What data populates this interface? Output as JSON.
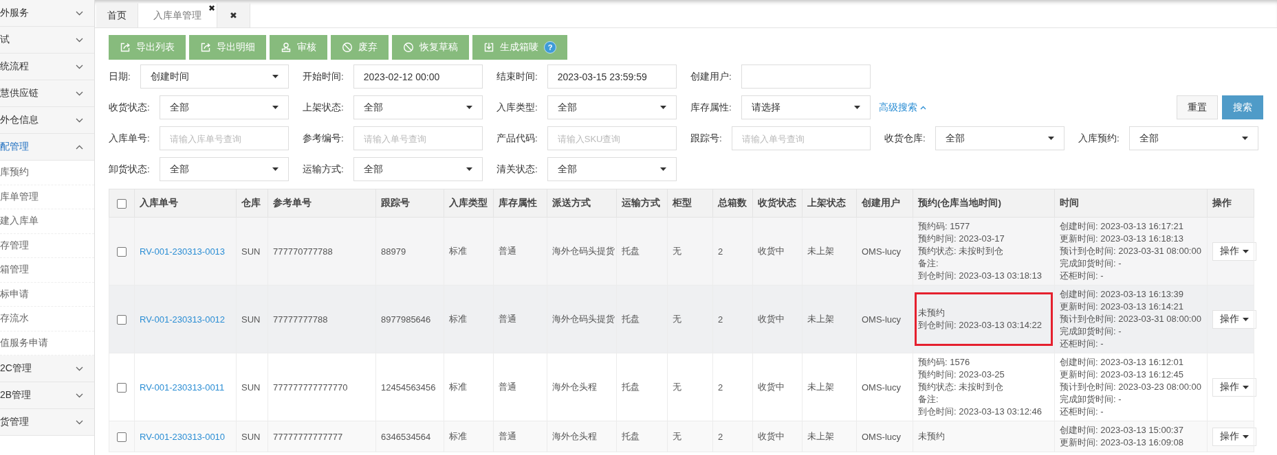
{
  "sidebar": {
    "groups": [
      {
        "label": "外服务",
        "expanded": false
      },
      {
        "label": "试",
        "expanded": false
      },
      {
        "label": "统流程",
        "expanded": false
      },
      {
        "label": "慧供应链",
        "expanded": false
      },
      {
        "label": "外仓信息",
        "expanded": false
      },
      {
        "label": "配管理",
        "expanded": true,
        "children": [
          {
            "label": "库预约"
          },
          {
            "label": "库单管理"
          },
          {
            "label": "建入库单"
          },
          {
            "label": "存管理"
          },
          {
            "label": "箱管理"
          },
          {
            "label": "标申请"
          },
          {
            "label": "存流水"
          },
          {
            "label": "值服务申请"
          }
        ]
      },
      {
        "label": "2C管理",
        "expanded": false
      },
      {
        "label": "2B管理",
        "expanded": false
      },
      {
        "label": "货管理",
        "expanded": false
      }
    ]
  },
  "tabs": [
    {
      "label": "首页",
      "selected": false
    },
    {
      "label": "入库单管理",
      "selected": true,
      "close": "✖"
    }
  ],
  "close_all_tab": "✖",
  "toolbar": [
    {
      "label": "导出列表"
    },
    {
      "label": "导出明细"
    },
    {
      "label": "审核"
    },
    {
      "label": "废弃"
    },
    {
      "label": "恢复草稿"
    },
    {
      "label": "生成箱唛",
      "help": "?"
    }
  ],
  "filters": [
    [
      {
        "label": "日期:",
        "kind": "select",
        "value": "创建时间"
      },
      {
        "label": "开始时间:",
        "kind": "input",
        "value": "2023-02-12 00:00"
      },
      {
        "label": "结束时间:",
        "kind": "input",
        "value": "2023-03-15 23:59:59"
      },
      {
        "label": "创建用户:",
        "kind": "input"
      }
    ],
    [
      {
        "label": "收货状态:",
        "kind": "select",
        "value": "全部"
      },
      {
        "label": "上架状态:",
        "kind": "select",
        "value": "全部"
      },
      {
        "label": "入库类型:",
        "kind": "select",
        "value": "全部"
      },
      {
        "label": "库存属性:",
        "kind": "select",
        "value": "请选择"
      }
    ],
    [
      {
        "label": "入库单号:",
        "kind": "input",
        "placeholder": "请输入库单号查询"
      },
      {
        "label": "参考编号:",
        "kind": "input",
        "placeholder": "请输入单号查询"
      },
      {
        "label": "产品代码:",
        "kind": "input",
        "placeholder": "请输入SKU查询"
      },
      {
        "label": "跟踪号:",
        "kind": "input",
        "placeholder": "请输入单号查询"
      },
      {
        "label": "收货仓库:",
        "kind": "select",
        "value": "全部"
      },
      {
        "label": "入库预约:",
        "kind": "select",
        "value": "全部"
      }
    ],
    [
      {
        "label": "卸货状态:",
        "kind": "select",
        "value": "全部"
      },
      {
        "label": "运输方式:",
        "kind": "select",
        "value": "全部"
      },
      {
        "label": "清关状态:",
        "kind": "select",
        "value": "全部"
      }
    ]
  ],
  "advanced_search": {
    "label": "高级搜索",
    "expanded": true
  },
  "reset_button": "重置",
  "search_button": "搜索",
  "table": {
    "columns": [
      {
        "kind": "link",
        "label": "入库单号"
      },
      {
        "kind": "text",
        "label": "仓库"
      },
      {
        "kind": "text",
        "label": "参考单号"
      },
      {
        "kind": "text",
        "label": "跟踪号"
      },
      {
        "kind": "text",
        "label": "入库类型"
      },
      {
        "kind": "text",
        "label": "库存属性"
      },
      {
        "kind": "text",
        "label": "派送方式"
      },
      {
        "kind": "text",
        "label": "运输方式"
      },
      {
        "kind": "text",
        "label": "柜型"
      },
      {
        "kind": "text",
        "label": "总箱数"
      },
      {
        "kind": "text",
        "label": "收货状态"
      },
      {
        "kind": "text",
        "label": "上架状态"
      },
      {
        "kind": "text",
        "label": "创建用户"
      },
      {
        "kind": "lines",
        "label": "预约(仓库当地时间)"
      },
      {
        "kind": "lines",
        "label": "时间"
      },
      {
        "kind": "action",
        "label": "操作"
      }
    ],
    "header_checked": false,
    "rows": [
      {
        "checked": false,
        "highlighted": false,
        "cells": [
          "RV-001-230313-0013",
          "SUN",
          "777770777788",
          "88979",
          "标准",
          "普通",
          "海外仓码头提货",
          "托盘",
          "无",
          "2",
          "收货中",
          "未上架",
          "OMS-lucy",
          [
            "预约码: 1577",
            "预约时间: 2023-03-17",
            "预约状态: 未按时到仓",
            "备注:",
            "到仓时间: 2023-03-13 03:18:13"
          ],
          [
            "创建时间: 2023-03-13 16:17:21",
            "更新时间: 2023-03-13 16:18:13",
            "预计到仓时间: 2023-03-31 08:00:00",
            "完成卸货时间: -",
            "还柜时间: -"
          ],
          "操作"
        ]
      },
      {
        "checked": false,
        "highlighted": true,
        "cells": [
          "RV-001-230313-0012",
          "SUN",
          "77777777788",
          "8977985646",
          "标准",
          "普通",
          "海外仓码头提货",
          "托盘",
          "无",
          "2",
          "收货中",
          "未上架",
          "OMS-lucy",
          [
            "未预约",
            "到仓时间: 2023-03-13 03:14:22"
          ],
          [
            "创建时间: 2023-03-13 16:13:39",
            "更新时间: 2023-03-13 16:14:21",
            "预计到仓时间: 2023-03-31 08:00:00",
            "完成卸货时间: -",
            "还柜时间: -"
          ],
          "操作"
        ]
      },
      {
        "checked": false,
        "highlighted": false,
        "cells": [
          "RV-001-230313-0011",
          "SUN",
          "777777777777770",
          "12454563456",
          "标准",
          "普通",
          "海外仓头程",
          "托盘",
          "无",
          "2",
          "收货中",
          "未上架",
          "OMS-lucy",
          [
            "预约码: 1576",
            "预约时间: 2023-03-25",
            "预约状态: 未按时到仓",
            "备注:",
            "到仓时间: 2023-03-13 03:12:46"
          ],
          [
            "创建时间: 2023-03-13 16:12:01",
            "更新时间: 2023-03-13 16:12:45",
            "预计到仓时间: 2023-03-23 08:00:00",
            "完成卸货时间: -",
            "还柜时间: -"
          ],
          "操作"
        ]
      },
      {
        "checked": false,
        "highlighted": false,
        "cells": [
          "RV-001-230313-0010",
          "SUN",
          "77777777777777",
          "6346534564",
          "标准",
          "普通",
          "海外仓头程",
          "托盘",
          "无",
          "2",
          "收货中",
          "未上架",
          "OMS-lucy",
          [
            "未预约"
          ],
          [
            "创建时间: 2023-03-13 15:00:37",
            "更新时间: 2023-03-13 16:09:08"
          ],
          "操作"
        ]
      }
    ]
  }
}
